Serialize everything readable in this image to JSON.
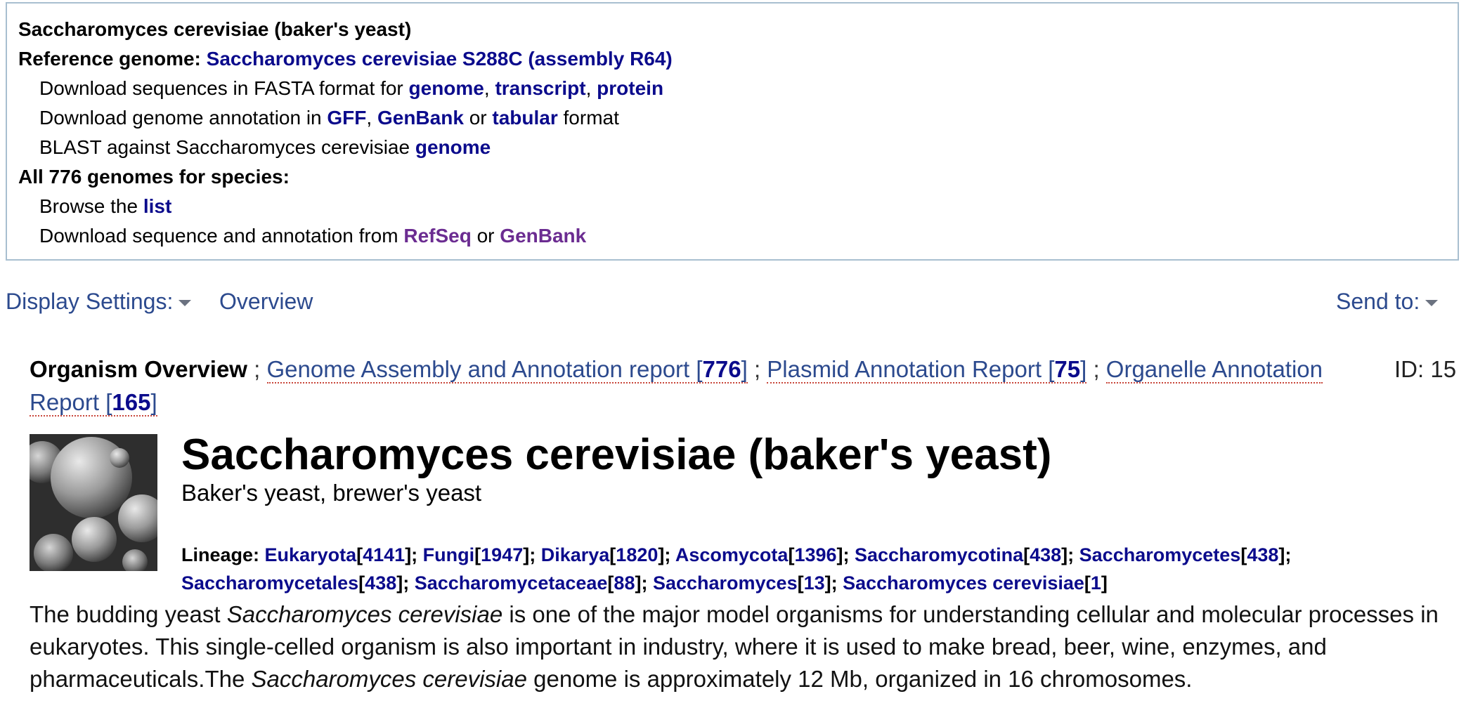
{
  "summary": {
    "org_title": "Saccharomyces cerevisiae (baker's yeast)",
    "ref_label": "Reference genome:",
    "ref_link": "Saccharomyces cerevisiae S288C (assembly R64)",
    "fasta_prefix": "Download sequences in FASTA format for",
    "fasta_links": [
      "genome",
      "transcript",
      "protein"
    ],
    "annot_prefix": "Download genome annotation in",
    "annot_links": [
      "GFF",
      "GenBank",
      "tabular"
    ],
    "annot_or": "or",
    "annot_suffix": "format",
    "blast_prefix": "BLAST against Saccharomyces cerevisiae",
    "blast_link": "genome",
    "all_label": "All 776 genomes for species:",
    "browse_prefix": "Browse the",
    "browse_link": "list",
    "dl_prefix": "Download sequence and annotation from",
    "dl_links": [
      "RefSeq",
      "GenBank"
    ],
    "dl_or": "or"
  },
  "display_bar": {
    "settings_label": "Display Settings:",
    "overview_label": "Overview",
    "send_label": "Send to:"
  },
  "reports": {
    "current": "Organism Overview",
    "tabs": [
      {
        "label": "Genome Assembly and Annotation report",
        "count": "776"
      },
      {
        "label": "Plasmid Annotation Report",
        "count": "75"
      },
      {
        "label": "Organelle Annotation Report",
        "count": "165"
      }
    ],
    "id_text": "ID: 15"
  },
  "organism": {
    "title": "Saccharomyces cerevisiae (baker's yeast)",
    "common_names": "Baker's yeast, brewer's yeast",
    "lineage_label": "Lineage:",
    "lineage": [
      {
        "name": "Eukaryota",
        "count": "4141"
      },
      {
        "name": "Fungi",
        "count": "1947"
      },
      {
        "name": "Dikarya",
        "count": "1820"
      },
      {
        "name": "Ascomycota",
        "count": "1396"
      },
      {
        "name": "Saccharomycotina",
        "count": "438"
      },
      {
        "name": "Saccharomycetes",
        "count": "438"
      },
      {
        "name": "Saccharomycetales",
        "count": "438"
      },
      {
        "name": "Saccharomycetaceae",
        "count": "88"
      },
      {
        "name": "Saccharomyces",
        "count": "13"
      },
      {
        "name": "Saccharomyces cerevisiae",
        "count": "1"
      }
    ],
    "description_parts": [
      {
        "text": "The budding yeast ",
        "italic": false
      },
      {
        "text": "Saccharomyces cerevisiae",
        "italic": true
      },
      {
        "text": " is one of the major model organisms for understanding cellular and molecular processes in eukaryotes. This single-celled organism is also important in industry, where it is used to make bread, beer, wine, enzymes, and pharmaceuticals.The ",
        "italic": false
      },
      {
        "text": "Saccharomyces cerevisiae",
        "italic": true
      },
      {
        "text": " genome is approximately 12 Mb, organized in 16 chromosomes.",
        "italic": false
      }
    ]
  },
  "colors": {
    "link": "#0b0b8c",
    "visited_link": "#6b2c91",
    "nav_link": "#2c4a8e",
    "box_border": "#a8bfd0"
  }
}
